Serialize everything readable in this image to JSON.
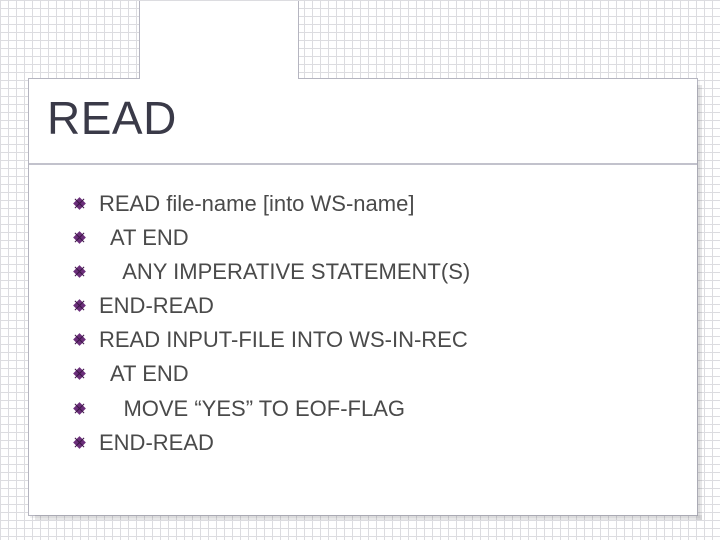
{
  "title": "READ",
  "items": [
    "READ file-name [into WS-name]",
    "  AT END",
    "    ANY IMPERATIVE STATEMENT(S)",
    "END-READ",
    "READ INPUT-FILE INTO WS-IN-REC",
    "  AT END",
    "    MOVE “YES” TO EOF-FLAG",
    "END-READ"
  ]
}
